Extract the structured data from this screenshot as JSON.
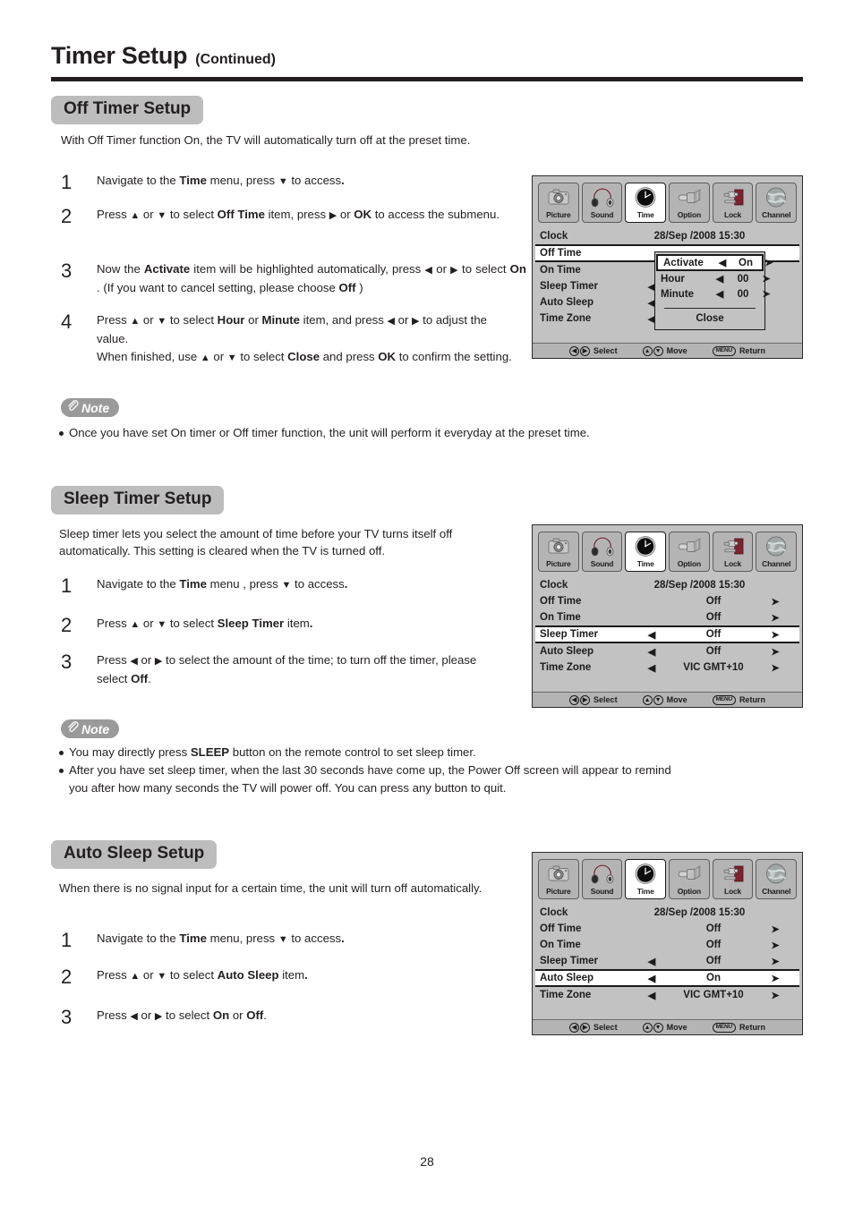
{
  "page": {
    "title_main": "Timer Setup",
    "title_sub": "(Continued)",
    "page_number": "28"
  },
  "sections": {
    "off_timer": {
      "heading": "Off Timer Setup",
      "intro": "With Off Timer function On, the TV will automatically turn off at the preset time.",
      "steps": [
        {
          "num": "1",
          "html": "Navigate to the <b>Time</b> menu,  press <span class=\"ar\">▼</span> to access<b>.</b>"
        },
        {
          "num": "2",
          "html": "Press <span class=\"ar\">▲</span> or <span class=\"ar\">▼</span>  to select <b>Off Time</b> item, press  <span class=\"ar\">▶</span> or <b>OK</b> to access the submenu."
        },
        {
          "num": "3",
          "html": "Now the <b>Activate</b> item will be highlighted automatically, press <span class=\"ar\">◀</span> or <span class=\"ar\">▶</span> to select <b>On</b> . (If you want to cancel setting, please choose <b>Off</b> )"
        },
        {
          "num": "4",
          "html": "Press <span class=\"ar\">▲</span> or <span class=\"ar\">▼</span>  to select <b>Hour</b> or <b>Minute</b> item, and press <span class=\"ar\">◀</span> or <span class=\"ar\">▶</span> to adjust the value.<br>When finished, use <span class=\"ar\">▲</span> or <span class=\"ar\">▼</span> to select <b>Close</b> and press <b>OK</b> to confirm the setting."
        }
      ],
      "note": {
        "label": "Note",
        "items": [
          "Once you have set On timer or Off timer function, the unit will perform it everyday at the preset time."
        ]
      }
    },
    "sleep_timer": {
      "heading": "Sleep Timer Setup",
      "intro": "Sleep timer lets you select the amount of time before your TV turns itself off automatically. This setting is cleared when the TV is turned off.",
      "steps": [
        {
          "num": "1",
          "html": "Navigate to the <b>Time</b> menu , press <span class=\"ar\">▼</span> to access<b>.</b>"
        },
        {
          "num": "2",
          "html": "Press <span class=\"ar\">▲</span> or <span class=\"ar\">▼</span>  to select <b>Sleep Timer</b> item<b>.</b>"
        },
        {
          "num": "3",
          "html": "Press <span class=\"ar\">◀</span> or <span class=\"ar\">▶</span> to select the amount of the time; to turn off the timer, please select <b>Off</b>."
        }
      ],
      "note": {
        "label": "Note",
        "items": [
          "You may directly press <b>SLEEP</b> button on the remote control to set sleep timer.",
          "After you have set sleep timer, when the last 30 seconds have come up, the Power Off screen will appear to remind you after how many seconds the TV will power off. You can press any button to quit."
        ]
      }
    },
    "auto_sleep": {
      "heading": "Auto Sleep Setup",
      "intro": "When there is no signal input for a certain time, the unit will turn off automatically.",
      "steps": [
        {
          "num": "1",
          "html": "Navigate to the <b>Time</b> menu,  press <span class=\"ar\">▼</span> to access<b>.</b>"
        },
        {
          "num": "2",
          "html": "Press <span class=\"ar\">▲</span> or <span class=\"ar\">▼</span>  to select <b>Auto Sleep</b> item<b>.</b>"
        },
        {
          "num": "3",
          "html": "Press <span class=\"ar\">◀</span> or <span class=\"ar\">▶</span> to select <b>On</b> or <b>Off</b>."
        }
      ]
    }
  },
  "osd": {
    "tabs": [
      {
        "label": "Picture",
        "icon": "camera-icon",
        "active": false
      },
      {
        "label": "Sound",
        "icon": "headphones-icon",
        "active": false
      },
      {
        "label": "Time",
        "icon": "clock-icon",
        "active": true
      },
      {
        "label": "Option",
        "icon": "connector-icon",
        "active": false
      },
      {
        "label": "Lock",
        "icon": "clamp-lock-icon",
        "active": false
      },
      {
        "label": "Channel",
        "icon": "globe-icon",
        "active": false
      }
    ],
    "statusbar": {
      "select_label": "Select",
      "move_label": "Move",
      "return_label": "Return",
      "menu_key": "MENU",
      "left_glyph": "◀",
      "right_glyph": "▶",
      "up_glyph": "▲",
      "down_glyph": "▼"
    },
    "screen1": {
      "rows": [
        {
          "label": "Clock",
          "left": "",
          "value": "28/Sep  /2008 15:30",
          "right": "",
          "selected": false,
          "clock": true
        },
        {
          "label": "Off Time",
          "left": "",
          "value": "",
          "right": "",
          "selected": true,
          "clock": false
        },
        {
          "label": "On Time",
          "left": "",
          "value": "",
          "right": "",
          "selected": false,
          "clock": false
        },
        {
          "label": "Sleep Timer",
          "left": "◀",
          "value": "",
          "right": "",
          "selected": false,
          "clock": false
        },
        {
          "label": "Auto Sleep",
          "left": "◀",
          "value": "",
          "right": "",
          "selected": false,
          "clock": false
        },
        {
          "label": "Time Zone",
          "left": "◀",
          "value": "",
          "right": "",
          "selected": false,
          "clock": false
        }
      ],
      "popup": {
        "rows": [
          {
            "label": "Activate",
            "left": "◀",
            "value": "On",
            "right": "➤",
            "selected": true
          },
          {
            "label": "Hour",
            "left": "◀",
            "value": "00",
            "right": "➤",
            "selected": false
          },
          {
            "label": "Minute",
            "left": "◀",
            "value": "00",
            "right": "➤",
            "selected": false
          }
        ],
        "close_label": "Close"
      }
    },
    "screen2": {
      "rows": [
        {
          "label": "Clock",
          "left": "",
          "value": "28/Sep  /2008 15:30",
          "right": "",
          "selected": false,
          "clock": true
        },
        {
          "label": "Off Time",
          "left": "",
          "value": "Off",
          "right": "➤",
          "selected": false,
          "clock": false
        },
        {
          "label": "On Time",
          "left": "",
          "value": "Off",
          "right": "➤",
          "selected": false,
          "clock": false
        },
        {
          "label": "Sleep Timer",
          "left": "◀",
          "value": "Off",
          "right": "➤",
          "selected": true,
          "clock": false
        },
        {
          "label": "Auto Sleep",
          "left": "◀",
          "value": "Off",
          "right": "➤",
          "selected": false,
          "clock": false
        },
        {
          "label": "Time Zone",
          "left": "◀",
          "value": "VIC GMT+10",
          "right": "➤",
          "selected": false,
          "clock": false
        }
      ]
    },
    "screen3": {
      "rows": [
        {
          "label": "Clock",
          "left": "",
          "value": "28/Sep  /2008 15:30",
          "right": "",
          "selected": false,
          "clock": true
        },
        {
          "label": "Off Time",
          "left": "",
          "value": "Off",
          "right": "➤",
          "selected": false,
          "clock": false
        },
        {
          "label": "On Time",
          "left": "",
          "value": "Off",
          "right": "➤",
          "selected": false,
          "clock": false
        },
        {
          "label": "Sleep Timer",
          "left": "◀",
          "value": "Off",
          "right": "➤",
          "selected": false,
          "clock": false
        },
        {
          "label": "Auto Sleep",
          "left": "◀",
          "value": "On",
          "right": "➤",
          "selected": true,
          "clock": false
        },
        {
          "label": "Time Zone",
          "left": "◀",
          "value": "VIC GMT+10",
          "right": "➤",
          "selected": false,
          "clock": false
        }
      ]
    }
  },
  "colors": {
    "badge_gray": "#bdbdbd",
    "note_gray": "#9a9a9a",
    "osd_gray": "#c2c2c2",
    "osd_tab_gray": "#b4b4b4",
    "ink": "#231f20"
  }
}
